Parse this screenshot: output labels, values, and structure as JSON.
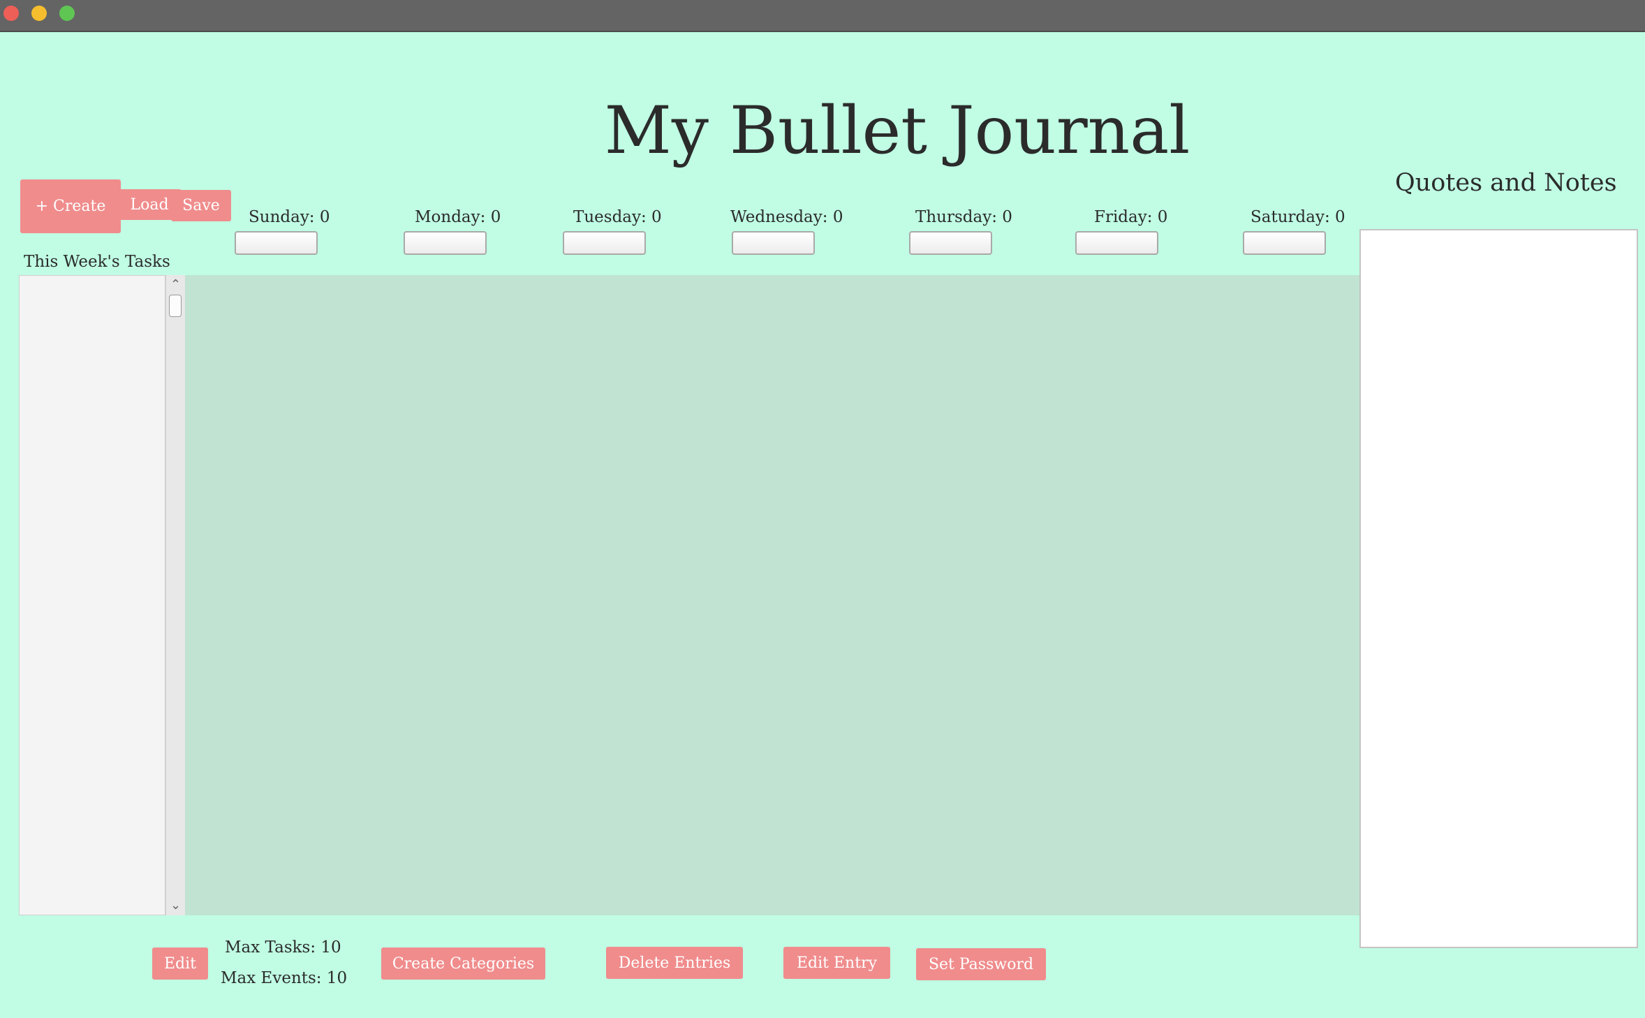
{
  "window": {
    "controls": [
      "close",
      "minimize",
      "maximize"
    ]
  },
  "header": {
    "title": "My Bullet Journal"
  },
  "toolbar": {
    "create_label": "+ Create",
    "load_label": "Load",
    "save_label": "Save"
  },
  "days": [
    {
      "label": "Sunday: 0",
      "input_value": ""
    },
    {
      "label": "Monday: 0",
      "input_value": ""
    },
    {
      "label": "Tuesday: 0",
      "input_value": ""
    },
    {
      "label": "Wednesday: 0",
      "input_value": ""
    },
    {
      "label": "Thursday: 0",
      "input_value": ""
    },
    {
      "label": "Friday: 0",
      "input_value": ""
    },
    {
      "label": "Saturday: 0",
      "input_value": ""
    }
  ],
  "tasks": {
    "heading": "This Week's Tasks",
    "items": []
  },
  "notes": {
    "heading": "Quotes and Notes",
    "text": ""
  },
  "footer": {
    "edit_label": "Edit",
    "max_tasks": "Max Tasks: 10",
    "max_events": "Max Events: 10",
    "create_categories_label": "Create Categories",
    "delete_entries_label": "Delete Entries",
    "edit_entry_label": "Edit Entry",
    "set_password_label": "Set Password"
  },
  "colors": {
    "background": "#c0fde4",
    "calendar_area": "#c0e3d2",
    "button": "#f08c8c",
    "text": "#2b2b2b"
  }
}
